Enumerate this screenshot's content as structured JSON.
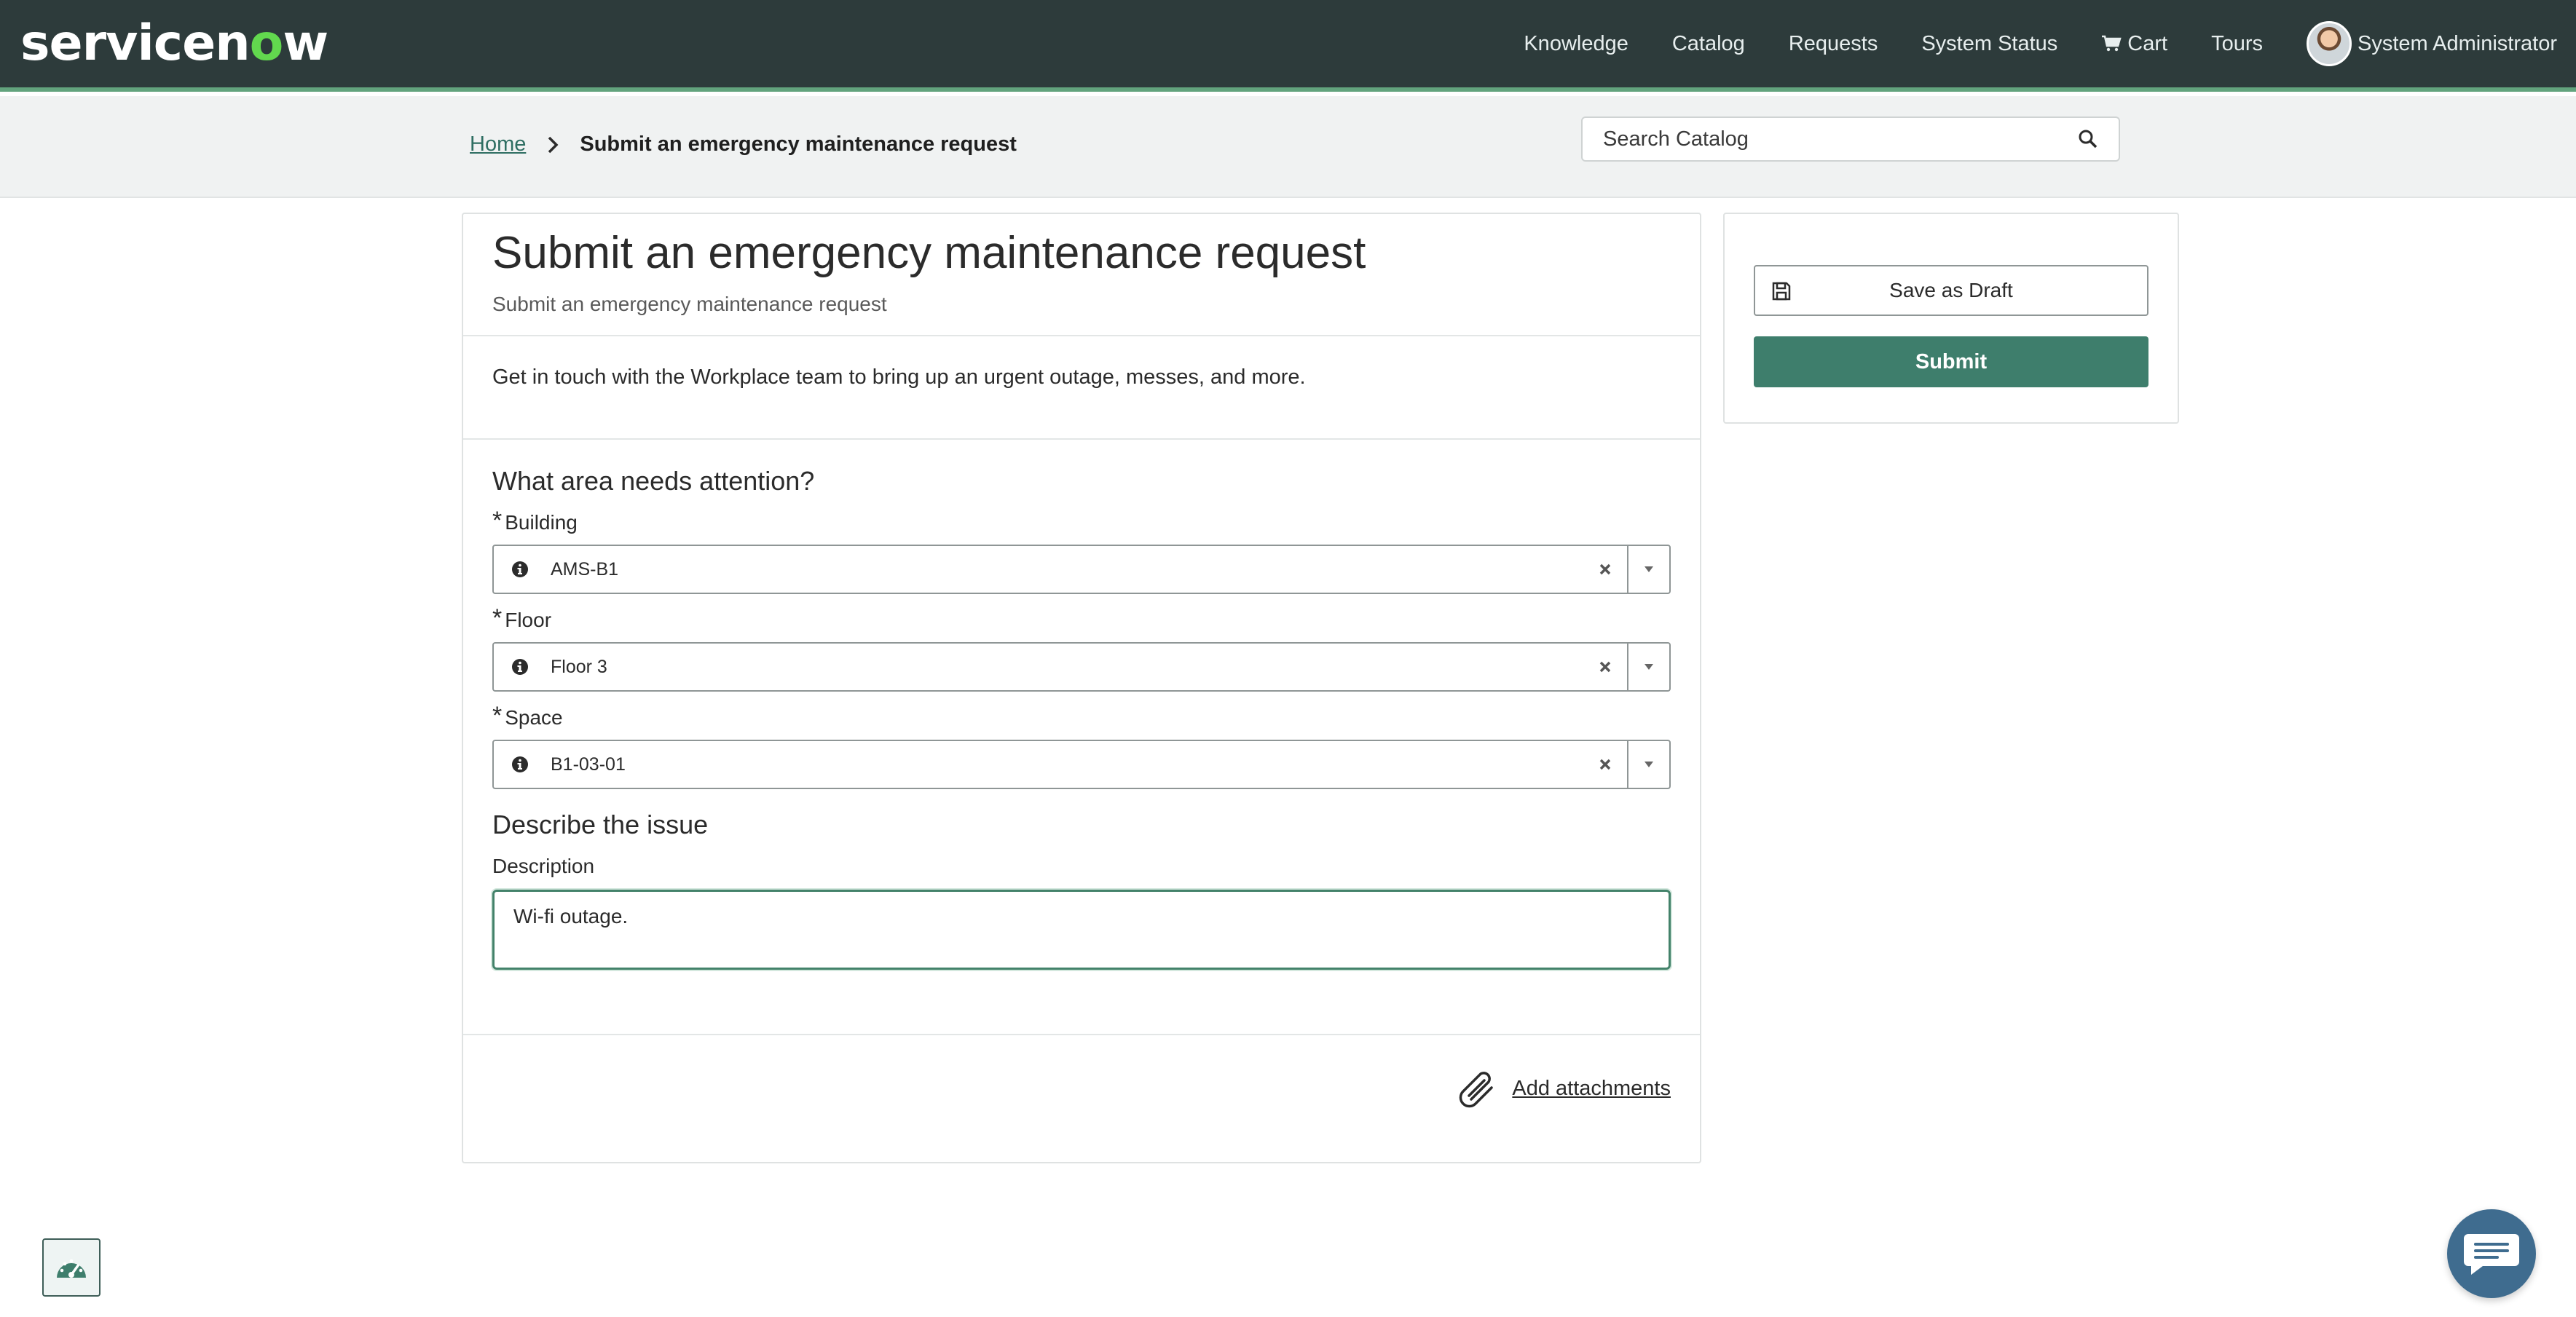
{
  "header": {
    "logo": {
      "part1": "servicen",
      "part2": "o",
      "part3": "w"
    },
    "nav": [
      {
        "label": "Knowledge"
      },
      {
        "label": "Catalog"
      },
      {
        "label": "Requests"
      },
      {
        "label": "System Status"
      },
      {
        "label": "Cart",
        "icon": "cart-icon"
      },
      {
        "label": "Tours"
      }
    ],
    "user": {
      "name": "System Administrator"
    }
  },
  "breadcrumb": {
    "home": "Home",
    "current": "Submit an emergency maintenance request"
  },
  "search": {
    "placeholder": "Search Catalog"
  },
  "form": {
    "title": "Submit an emergency maintenance request",
    "subtitle": "Submit an emergency maintenance request",
    "description": "Get in touch with the Workplace team to bring up an urgent outage, messes, and more.",
    "section1_title": "What area needs attention?",
    "fields": [
      {
        "label": "Building",
        "value": "AMS-B1",
        "required": true
      },
      {
        "label": "Floor",
        "value": "Floor 3",
        "required": true
      },
      {
        "label": "Space",
        "value": "B1-03-01",
        "required": true
      }
    ],
    "required_marker": "*",
    "section2_title": "Describe the issue",
    "description_label": "Description",
    "description_value": "Wi-fi outage.",
    "attachments_label": "Add attachments"
  },
  "side": {
    "save_draft_label": "Save as Draft",
    "submit_label": "Submit"
  },
  "colors": {
    "header_bg": "#2d3b3b",
    "accent": "#62a37d",
    "submit_bg": "#3e7e6c",
    "chat_bg": "#3f6c8f"
  }
}
